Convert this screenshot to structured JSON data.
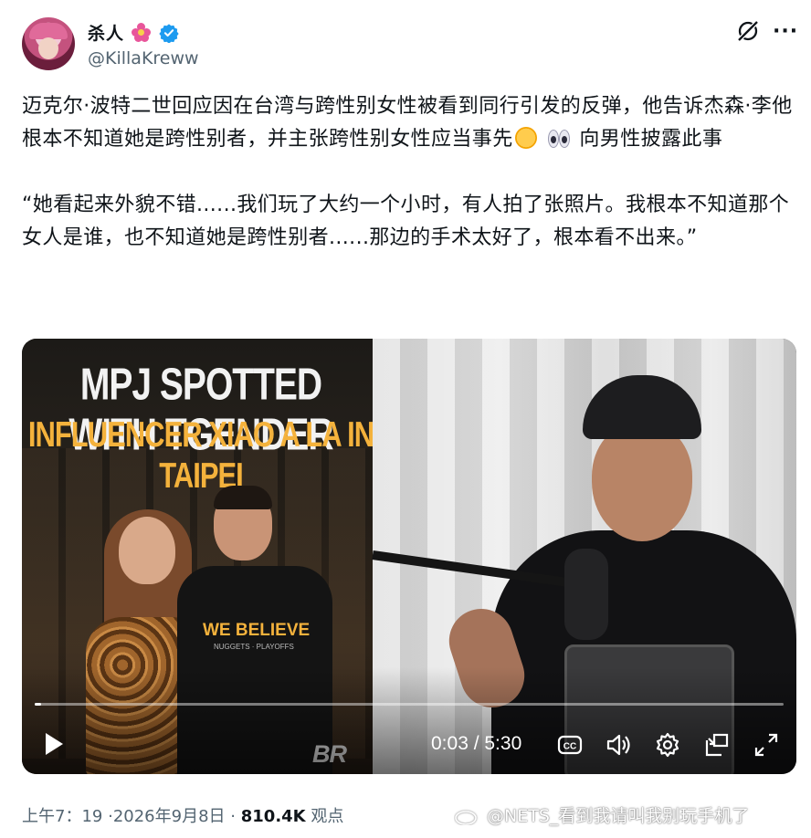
{
  "author": {
    "display_name": "杀人",
    "handle": "@KillaKreww",
    "verified": true,
    "name_emoji": "flower-icon",
    "brand_color": "#1d9bf0"
  },
  "tweet": {
    "paragraph1": "迈克尔·波特二世回应因在台湾与跨性别女性被看到同行引发的反弹，他告诉杰森·李他根本不知道她是跨性别者，并主张跨性别女性应当事先",
    "paragraph1_emojis": [
      "flushed-face-icon",
      "eyes-icon"
    ],
    "paragraph1_tail": "向男性披露此事",
    "paragraph2": "“她看起来外貌不错......我们玩了大约一个小时，有人拍了张照片。我根本不知道那个女人是谁，也不知道她是跨性别者......那边的手术太好了，根本看不出来。”"
  },
  "media": {
    "thumbnail_headline_line1": "MPJ SPOTTED WITH TGENDER",
    "thumbnail_headline_line2": "INFLUENCER XIAO A LA IN TAIPEI",
    "shirt_text": "WE BELIEVE",
    "shirt_subtext": "NUGGETS · PLAYOFFS",
    "logo_text": "BR",
    "video": {
      "current_time": "0:03",
      "duration": "5:30",
      "time_display": "0:03 / 5:30",
      "progress_fraction": 0.009
    },
    "controls": [
      "play-icon",
      "cc-icon",
      "volume-icon",
      "settings-icon",
      "pip-icon",
      "fullscreen-icon"
    ]
  },
  "meta": {
    "time": "上午7：19",
    "separator": "·",
    "date": "2026年9月8日",
    "views_count": "810.4K",
    "views_label": "观点"
  },
  "watermark": {
    "text": "@NETS_看到我请叫我别玩手机了"
  }
}
